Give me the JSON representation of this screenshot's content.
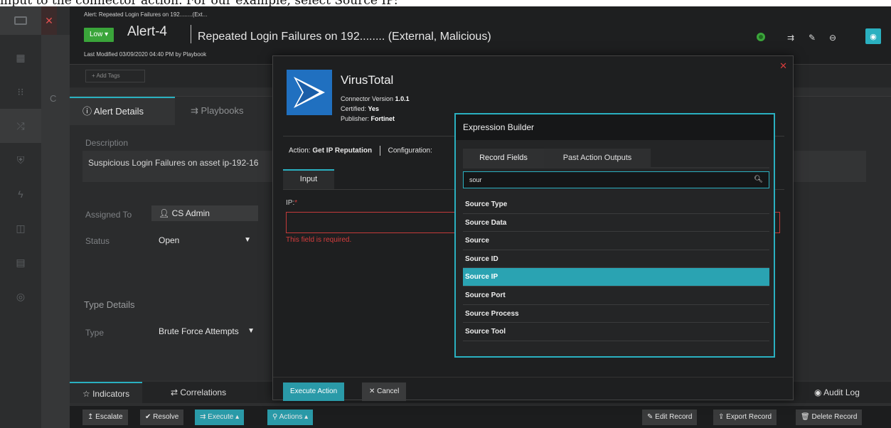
{
  "caption": "input to the connector action. For our example, select Source IP:",
  "header": {
    "breadcrumb": "Alert: Repeated Login Failures on 192........(Ext...",
    "severity": "Low",
    "alert_id": "Alert-4",
    "alert_title": "Repeated Login Failures on 192........ (External, Malicious)",
    "last_modified": "Last Modified 03/09/2020 04:40 PM by Playbook",
    "add_tags": "+ Add Tags"
  },
  "details": {
    "tab_details": "Alert Details",
    "tab_playbooks": "Playbooks",
    "description_label": "Description",
    "description_value": "Suspicious Login Failures on asset ip-192-16",
    "assigned_label": "Assigned To",
    "assigned_value": "CS Admin",
    "status_label": "Status",
    "status_value": "Open",
    "type_details_title": "Type Details",
    "type_label": "Type",
    "type_value": "Brute Force Attempts"
  },
  "bottom_tabs": {
    "indicators": "Indicators",
    "correlations": "Correlations",
    "audit_log": "Audit Log"
  },
  "action_bar": {
    "escalate": "Escalate",
    "resolve": "Resolve",
    "execute": "Execute",
    "actions": "Actions",
    "edit_record": "Edit Record",
    "export_record": "Export Record",
    "delete_record": "Delete Record"
  },
  "connector_modal": {
    "name": "VirusTotal",
    "version_label": "Connector Version",
    "version": "1.0.1",
    "certified_label": "Certified:",
    "certified": "Yes",
    "publisher_label": "Publisher:",
    "publisher": "Fortinet",
    "action_label": "Action:",
    "action_value": "Get IP Reputation",
    "configuration_label": "Configuration:",
    "input_tab": "Input",
    "ip_label": "IP:",
    "required_mark": "*",
    "error_text": "This field is required.",
    "execute_button": "Execute Action",
    "cancel_button": "Cancel"
  },
  "expression_builder": {
    "title": "Expression Builder",
    "tab_record_fields": "Record Fields",
    "tab_past_outputs": "Past Action Outputs",
    "search_value": "sour",
    "items": [
      "Source Type",
      "Source Data",
      "Source",
      "Source ID",
      "Source IP",
      "Source Port",
      "Source Process",
      "Source Tool"
    ],
    "selected_index": 4
  },
  "colors": {
    "accent": "#2ab0c0",
    "severity_low": "#3aa53a",
    "error": "#d63c3c",
    "background": "#2e2f30"
  }
}
